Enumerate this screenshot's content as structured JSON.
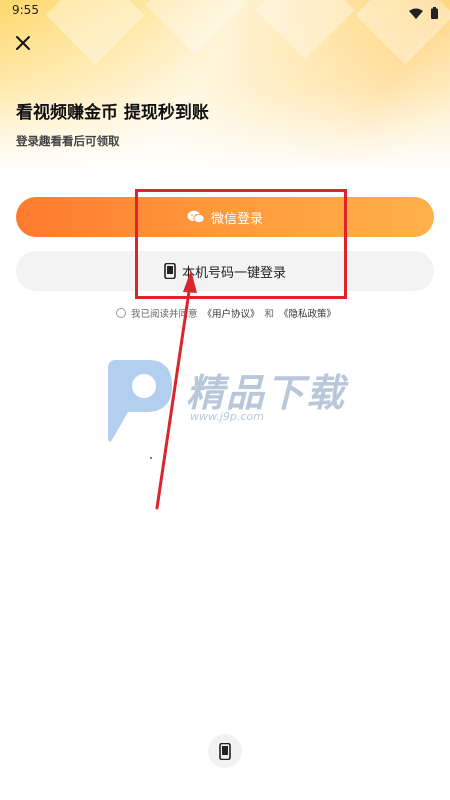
{
  "status_bar": {
    "time": "9:55"
  },
  "header": {
    "headline": "看视频赚金币 提现秒到账",
    "subline": "登录趣看看后可领取"
  },
  "buttons": {
    "wechat_login": "微信登录",
    "phone_login": "本机号码一键登录"
  },
  "agreement": {
    "prefix": "我已阅读并同意",
    "user_agreement": "《用户协议》",
    "and": "和",
    "privacy_policy": "《隐私政策》"
  },
  "watermark": {
    "brand": "精品下载",
    "url": "www.j9p.com"
  },
  "icons": {
    "close": "close-icon",
    "wechat": "wechat-icon",
    "phone": "phone-icon",
    "wifi": "wifi-icon",
    "battery": "battery-icon"
  },
  "colors": {
    "accent_orange": "#ff8a35",
    "highlight_red": "#e0232a"
  }
}
